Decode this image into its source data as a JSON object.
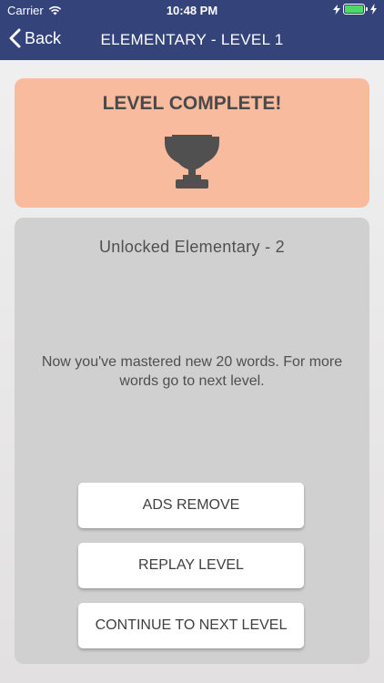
{
  "status": {
    "carrier": "Carrier",
    "time": "10:48 PM",
    "battery_level": 1.0
  },
  "nav": {
    "back_label": "Back",
    "title": "ELEMENTARY - LEVEL 1"
  },
  "complete": {
    "title": "LEVEL COMPLETE!",
    "icon": "trophy-icon"
  },
  "info": {
    "unlocked": "Unlocked Elementary - 2",
    "message": "Now you've mastered new 20 words. For more words go to next level."
  },
  "buttons": {
    "ads_remove": "ADS REMOVE",
    "replay": "REPLAY LEVEL",
    "continue": "CONTINUE TO NEXT LEVEL"
  },
  "colors": {
    "nav_bg": "#34437a",
    "complete_bg": "#f9bb9d",
    "card_bg": "#d0d0d0",
    "battery": "#4cd964"
  }
}
